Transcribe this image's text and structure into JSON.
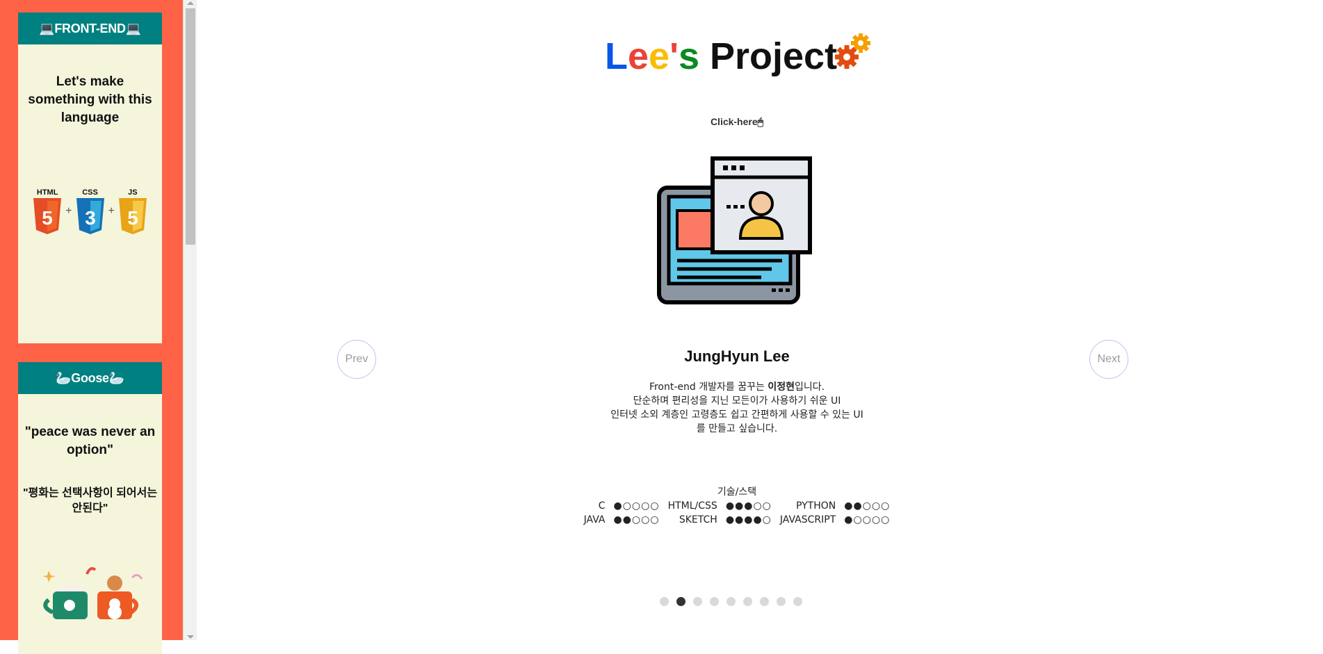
{
  "sidebar": {
    "card1": {
      "header": "💻FRONT-END💻",
      "text": "Let's make something with this language",
      "logos": [
        {
          "label": "HTML",
          "glyph": "5",
          "color": "#e44d26"
        },
        {
          "label": "CSS",
          "glyph": "3",
          "color": "#1572b6"
        },
        {
          "label": "JS",
          "glyph": "5",
          "color": "#f0b429"
        }
      ],
      "plus": "+"
    },
    "card2": {
      "header": "🦢Goose🦢",
      "quote_en": "\"peace was never an option\"",
      "quote_ko": "\"평화는 선택사항이 되어서는 안된다\""
    }
  },
  "main": {
    "title": {
      "p1": "L",
      "p2": "e",
      "p3": "e",
      "p4": "'",
      "p5": "s",
      "rest": " Project"
    },
    "click_hint": "Click-here🖱",
    "prev_label": "Prev",
    "next_label": "Next",
    "name": "JungHyun Lee",
    "desc": {
      "line1_a": "Front-end 개발자를 꿈꾸는 ",
      "line1_b": "이정현",
      "line1_c": "입니다.",
      "line2": "단순하며 편리성을 지닌 모든이가 사용하기 쉬운 UI",
      "line3": "인터넷 소외 계층인 고령층도 쉽고 간편하게 사용할 수 있는 UI",
      "line4": "를 만들고 싶습니다."
    },
    "stack_title": "기술/스택",
    "skills": [
      {
        "name": "C",
        "level": "●○○○○"
      },
      {
        "name": "HTML/CSS",
        "level": "●●●○○"
      },
      {
        "name": "PYTHON",
        "level": "●●○○○"
      },
      {
        "name": "JAVA",
        "level": "●●○○○"
      },
      {
        "name": "SKETCH",
        "level": "●●●●○"
      },
      {
        "name": "JAVASCRIPT",
        "level": "●○○○○"
      }
    ],
    "pagination": {
      "count": 9,
      "active_index": 1
    }
  }
}
